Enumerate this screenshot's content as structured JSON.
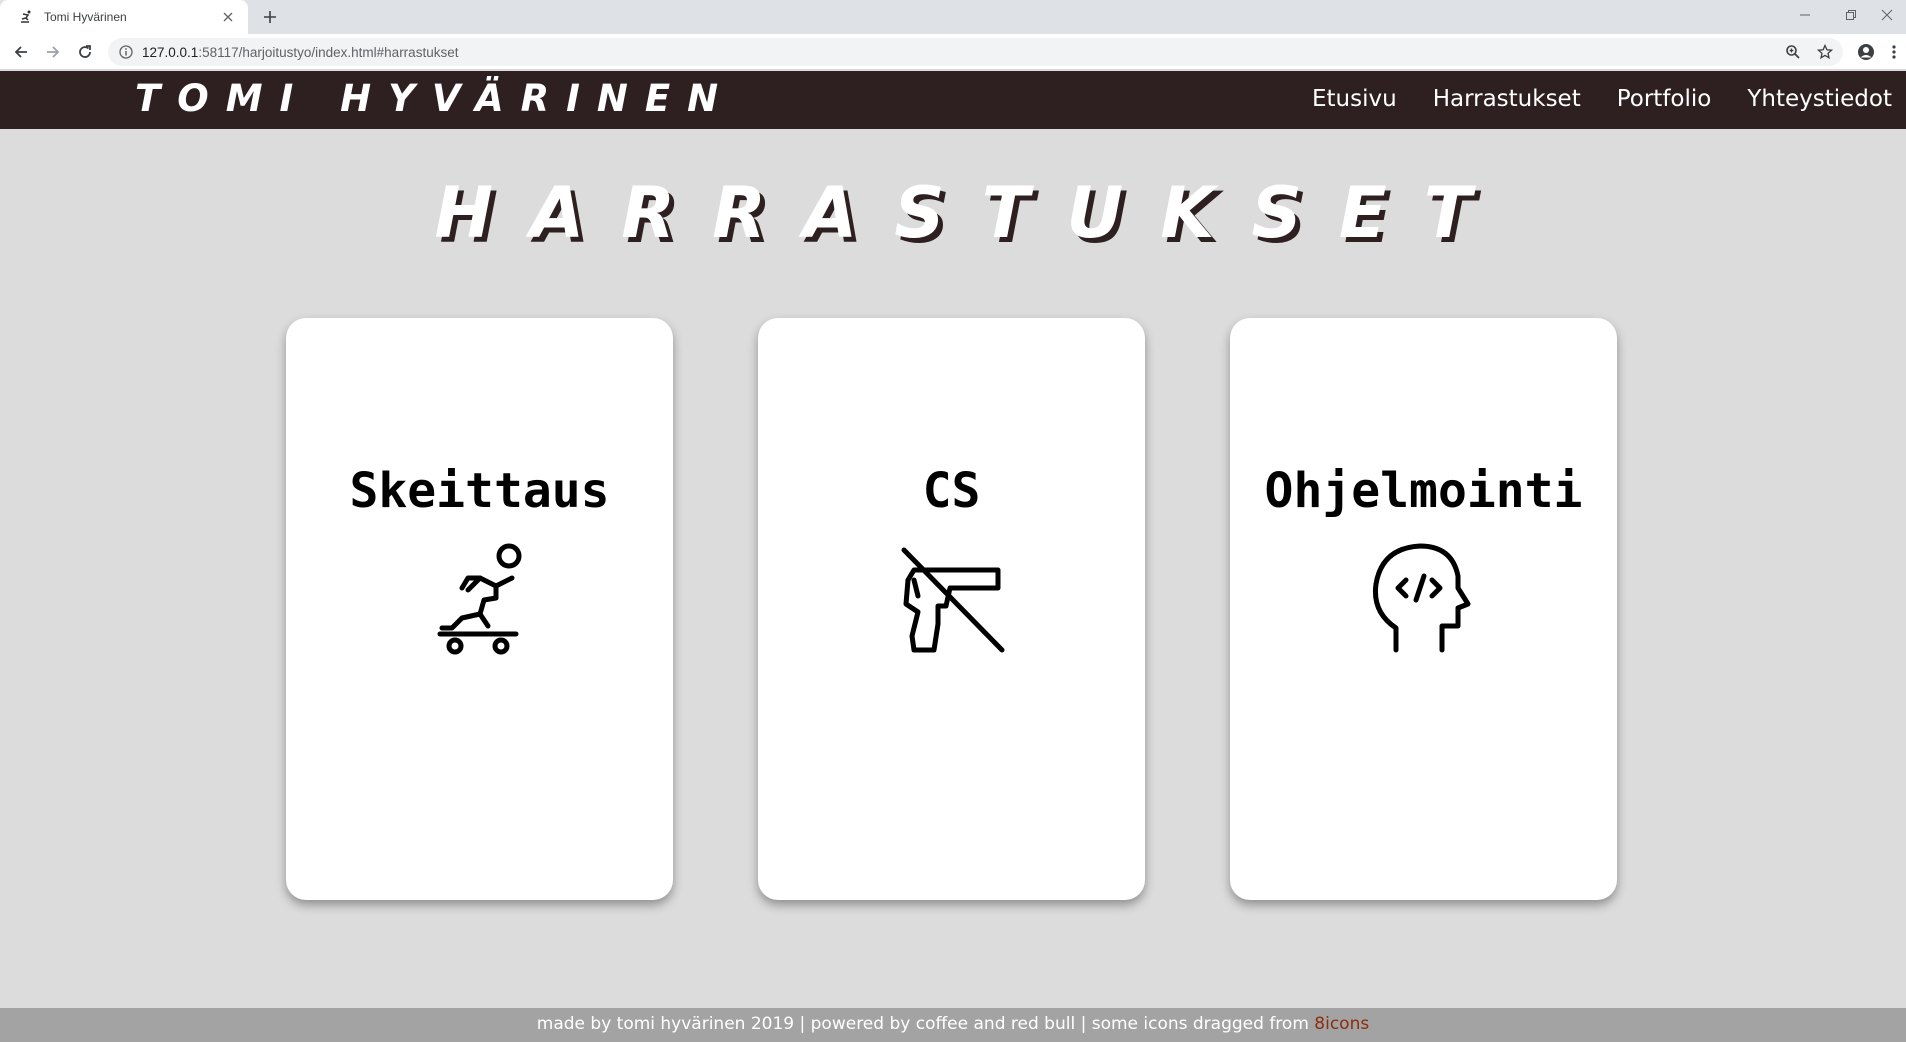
{
  "browser": {
    "tab_title": "Tomi Hyvärinen",
    "url_host": "127.0.0.1",
    "url_rest": ":58117/harjoitustyo/index.html#harrastukset"
  },
  "site": {
    "logo": "Tomi Hyvärinen",
    "nav": [
      "Etusivu",
      "Harrastukset",
      "Portfolio",
      "Yhteystiedot"
    ]
  },
  "page": {
    "title": "Harrastukset"
  },
  "cards": [
    {
      "title": "Skeittaus",
      "icon": "skateboarder-icon"
    },
    {
      "title": "CS",
      "icon": "no-gun-icon"
    },
    {
      "title": "Ohjelmointi",
      "icon": "coding-head-icon"
    }
  ],
  "footer": {
    "text": "made by tomi hyvärinen 2019 | powered by coffee and red bull | some icons dragged from ",
    "link": "8icons"
  },
  "colors": {
    "header_bg": "#2e2020",
    "page_bg": "#dcdcdc",
    "footer_bg": "#a3a3a3",
    "footer_link": "#8b2d0e"
  }
}
